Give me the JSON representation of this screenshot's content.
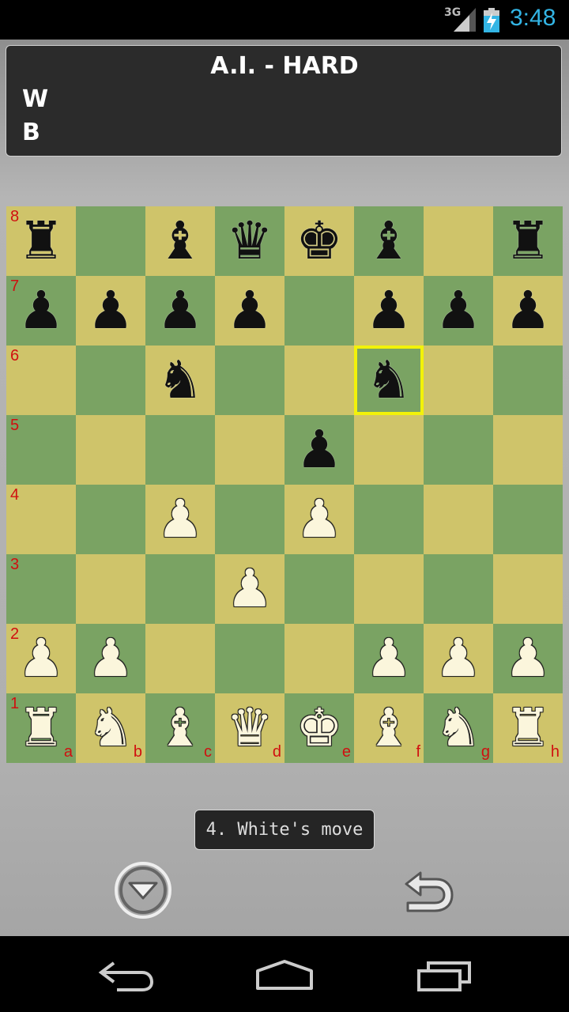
{
  "status_bar": {
    "network": "3G",
    "clock": "3:48"
  },
  "header": {
    "title": "A.I. - HARD",
    "white_label": "W",
    "black_label": "B"
  },
  "board": {
    "files": [
      "a",
      "b",
      "c",
      "d",
      "e",
      "f",
      "g",
      "h"
    ],
    "ranks": [
      "8",
      "7",
      "6",
      "5",
      "4",
      "3",
      "2",
      "1"
    ],
    "selected_square": "f6",
    "position": [
      [
        "br",
        "",
        "bb",
        "bq",
        "bk",
        "bb",
        "",
        "br"
      ],
      [
        "bp",
        "bp",
        "bp",
        "bp",
        "",
        "bp",
        "bp",
        "bp"
      ],
      [
        "",
        "",
        "bn",
        "",
        "",
        "bn",
        "",
        ""
      ],
      [
        "",
        "",
        "",
        "",
        "bp",
        "",
        "",
        ""
      ],
      [
        "",
        "",
        "wp",
        "",
        "wp",
        "",
        "",
        ""
      ],
      [
        "",
        "",
        "",
        "wp",
        "",
        "",
        "",
        ""
      ],
      [
        "wp",
        "wp",
        "",
        "",
        "",
        "wp",
        "wp",
        "wp"
      ],
      [
        "wr",
        "wn",
        "wb",
        "wq",
        "wk",
        "wb",
        "wn",
        "wr"
      ]
    ],
    "colors": {
      "light": "#cfc46a",
      "dark": "#7aa363",
      "highlight": "#f2f20a",
      "label": "#d01010"
    }
  },
  "move_status": "4. White's move",
  "controls": {
    "menu_icon": "triangle-down-icon",
    "undo_icon": "undo-arrow-icon"
  },
  "nav": {
    "back_icon": "back-icon",
    "home_icon": "home-icon",
    "recent_icon": "recent-apps-icon"
  }
}
